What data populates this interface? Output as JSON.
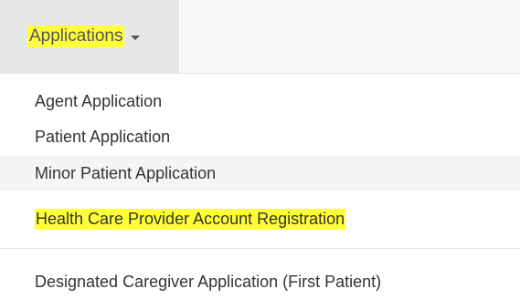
{
  "navbar": {
    "dropdown_label": "Applications",
    "caret_icon": "caret-down-icon",
    "highlight_color": "#ffff3a"
  },
  "menu": {
    "items": [
      {
        "label": "Agent Application"
      },
      {
        "label": "Patient Application"
      },
      {
        "label": "Minor Patient Application",
        "hovered": true
      },
      {
        "label": "Health Care Provider Account Registration",
        "highlighted": true
      },
      {
        "label": "Designated Caregiver Application (First Patient)"
      }
    ]
  }
}
